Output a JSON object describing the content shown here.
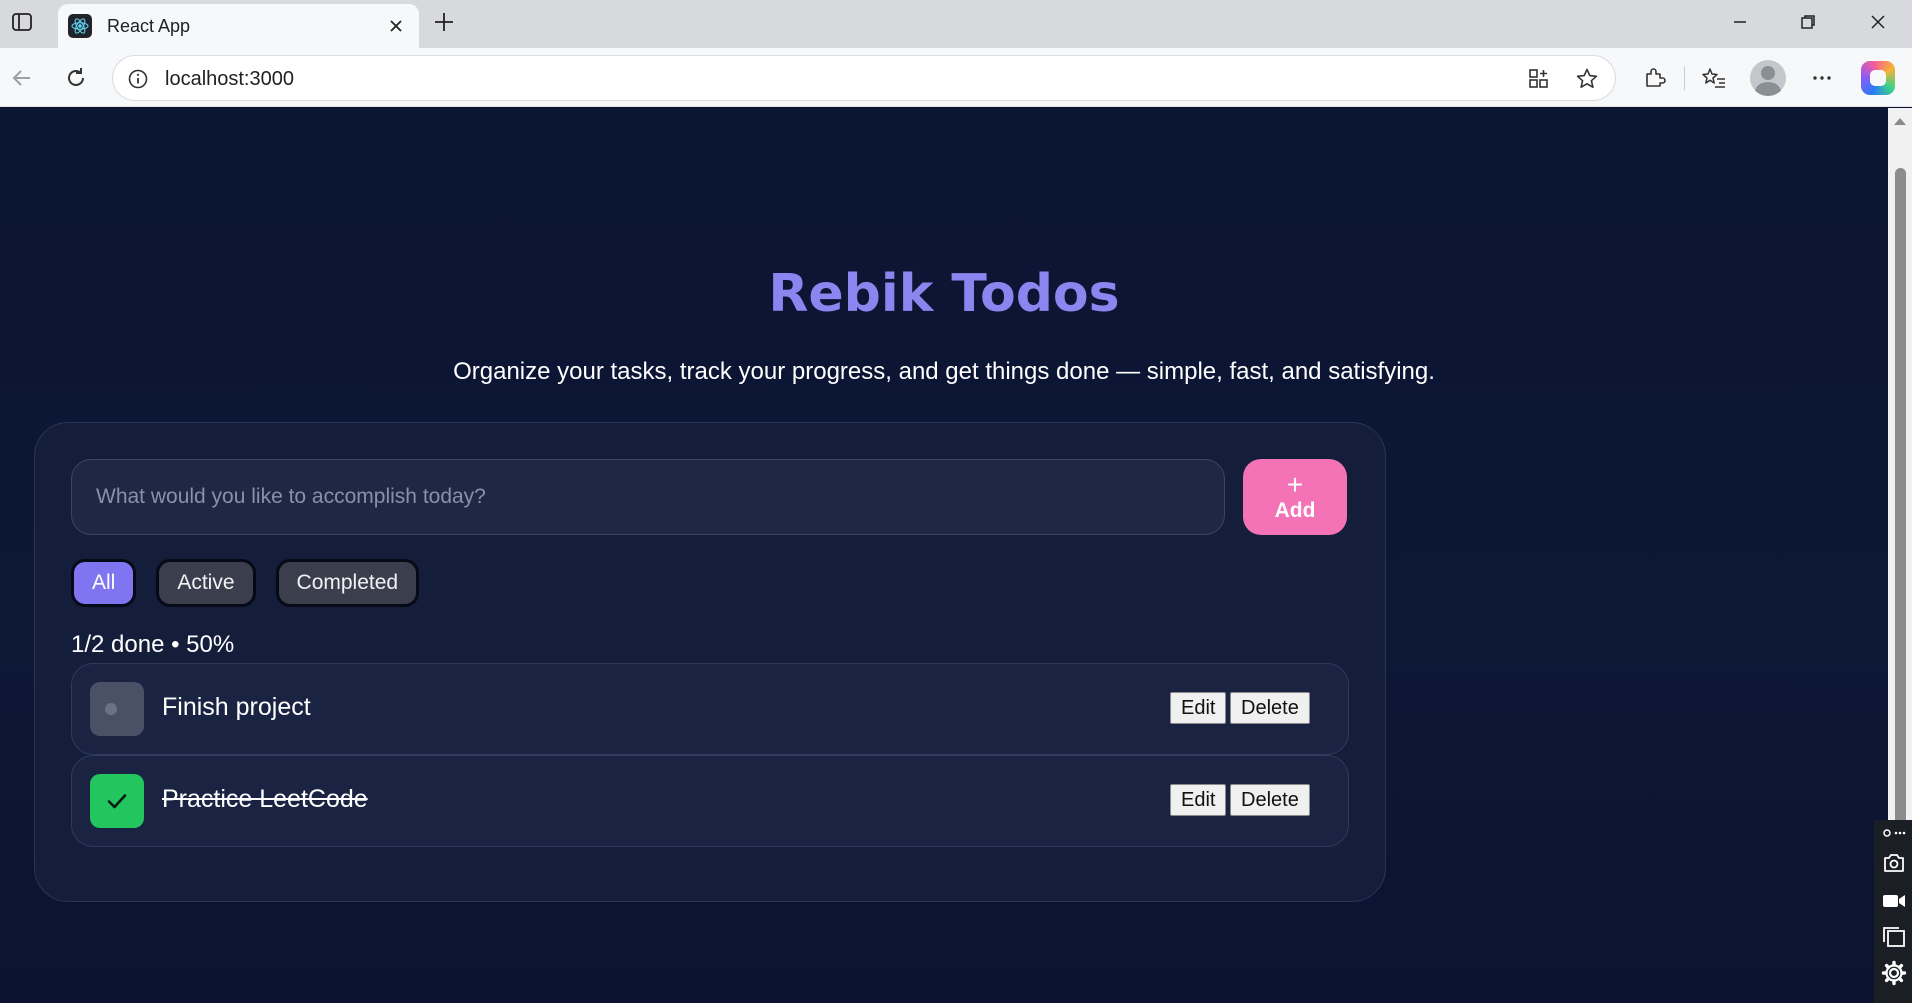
{
  "browser": {
    "tab_title": "React App",
    "url": "localhost:3000"
  },
  "app": {
    "title": "Rebik Todos",
    "subtitle": "Organize your tasks, track your progress, and get things done — simple, fast, and satisfying.",
    "input_placeholder": "What would you like to accomplish today?",
    "add_icon": "+",
    "add_label": "Add",
    "filters": [
      {
        "label": "All",
        "active": true
      },
      {
        "label": "Active",
        "active": false
      },
      {
        "label": "Completed",
        "active": false
      }
    ],
    "progress_text": "1/2 done • 50%",
    "todos": [
      {
        "text": "Finish project",
        "completed": false,
        "edit_label": "Edit",
        "delete_label": "Delete"
      },
      {
        "text": "Practice LeetCode",
        "completed": true,
        "edit_label": "Edit",
        "delete_label": "Delete"
      }
    ]
  },
  "colors": {
    "title": "#8b86ef",
    "add_button": "#f472b6",
    "active_filter": "#8075f0",
    "completed_check": "#22c55e"
  }
}
